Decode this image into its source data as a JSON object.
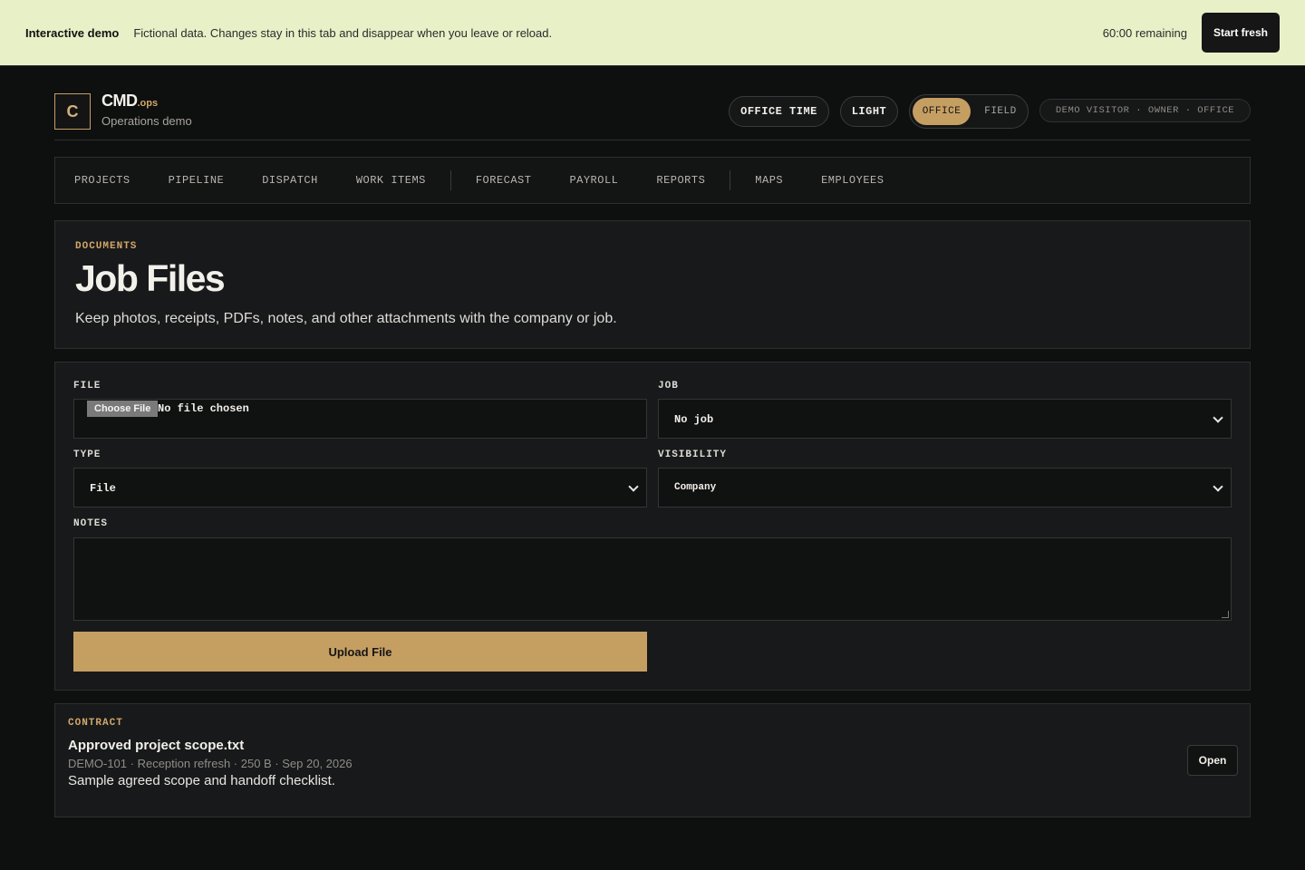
{
  "banner": {
    "title": "Interactive demo",
    "description": "Fictional data. Changes stay in this tab and disappear when you leave or reload.",
    "timer": "60:00 remaining",
    "start_fresh_label": "Start fresh"
  },
  "header": {
    "logo_letter": "C",
    "brand_name": "CMD",
    "brand_suffix": ".ops",
    "subtitle": "Operations demo",
    "office_time_label": "OFFICE TIME",
    "light_label": "LIGHT",
    "mode_office": "OFFICE",
    "mode_field": "FIELD",
    "active_mode": "OFFICE",
    "user_info": "DEMO VISITOR · OWNER · OFFICE"
  },
  "nav": {
    "items": [
      "PROJECTS",
      "PIPELINE",
      "DISPATCH",
      "WORK ITEMS",
      "FORECAST",
      "PAYROLL",
      "REPORTS",
      "MAPS",
      "EMPLOYEES"
    ]
  },
  "hero": {
    "eyebrow": "DOCUMENTS",
    "title": "Job Files",
    "lead": "Keep photos, receipts, PDFs, notes, and other attachments with the company or job."
  },
  "form": {
    "file_label": "FILE",
    "choose_file_label": "Choose File",
    "no_file_text": "No file chosen",
    "job_label": "JOB",
    "job_value": "No job",
    "type_label": "TYPE",
    "type_value": "File",
    "visibility_label": "VISIBILITY",
    "visibility_value": "Company",
    "notes_label": "NOTES",
    "notes_value": "",
    "upload_label": "Upload File"
  },
  "files": [
    {
      "category": "CONTRACT",
      "name": "Approved project scope.txt",
      "meta": "DEMO-101 · Reception refresh · 250 B · Sep 20, 2026",
      "note": "Sample agreed scope and handoff checklist.",
      "open_label": "Open"
    }
  ],
  "colors": {
    "accent": "#c59f62",
    "banner_bg": "#e8f0c8",
    "page_bg": "#0e0f0f"
  }
}
